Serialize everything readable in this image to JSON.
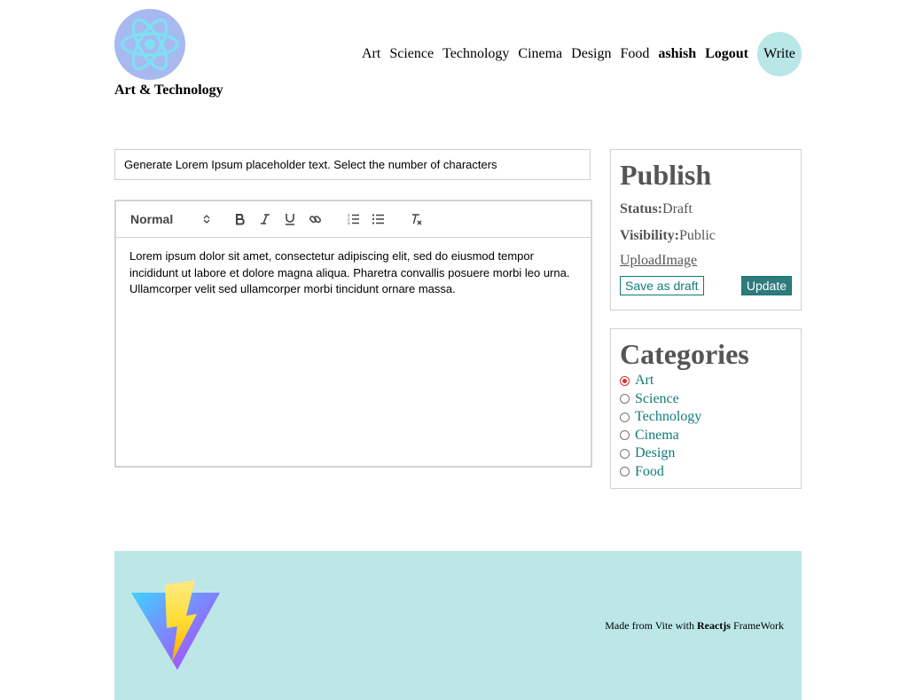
{
  "header": {
    "site_title": "Art & Technology",
    "logo_icon": "react-atom-icon",
    "nav": [
      "Art",
      "Science",
      "Technology",
      "Cinema",
      "Design",
      "Food"
    ],
    "user": "ashish",
    "logout": "Logout",
    "write": "Write"
  },
  "editor": {
    "title_value": "Generate Lorem Ipsum placeholder text. Select the number of characters",
    "toolbar": {
      "heading_select": "Normal",
      "buttons": [
        "bold-icon",
        "italic-icon",
        "underline-icon",
        "link-icon",
        "ordered-list-icon",
        "bullet-list-icon",
        "clear-format-icon"
      ]
    },
    "content": "Lorem ipsum dolor sit amet, consectetur adipiscing elit, sed do eiusmod tempor incididunt ut labore et dolore magna aliqua. Pharetra convallis posuere morbi leo urna. Ullamcorper velit sed ullamcorper morbi tincidunt ornare massa."
  },
  "publish": {
    "heading": "Publish",
    "status_label": "Status:",
    "status_value": "Draft",
    "visibility_label": "Visibility:",
    "visibility_value": "Public",
    "upload": "UploadImage",
    "save_draft": "Save as draft",
    "update": "Update"
  },
  "categories": {
    "heading": "Categories",
    "items": [
      "Art",
      "Science",
      "Technology",
      "Cinema",
      "Design",
      "Food"
    ],
    "selected": "Art"
  },
  "footer": {
    "logo_icon": "vite-logo-icon",
    "text_prefix": "Made from Vite with",
    "text_bold": "Reactjs",
    "text_suffix": "FrameWork"
  },
  "colors": {
    "accent": "#117a7a",
    "footer_bg": "#bde7e7",
    "write_bg": "#b9e6e6",
    "logo_bg": "#a7b9ef",
    "radio_checked": "#d9302f"
  }
}
